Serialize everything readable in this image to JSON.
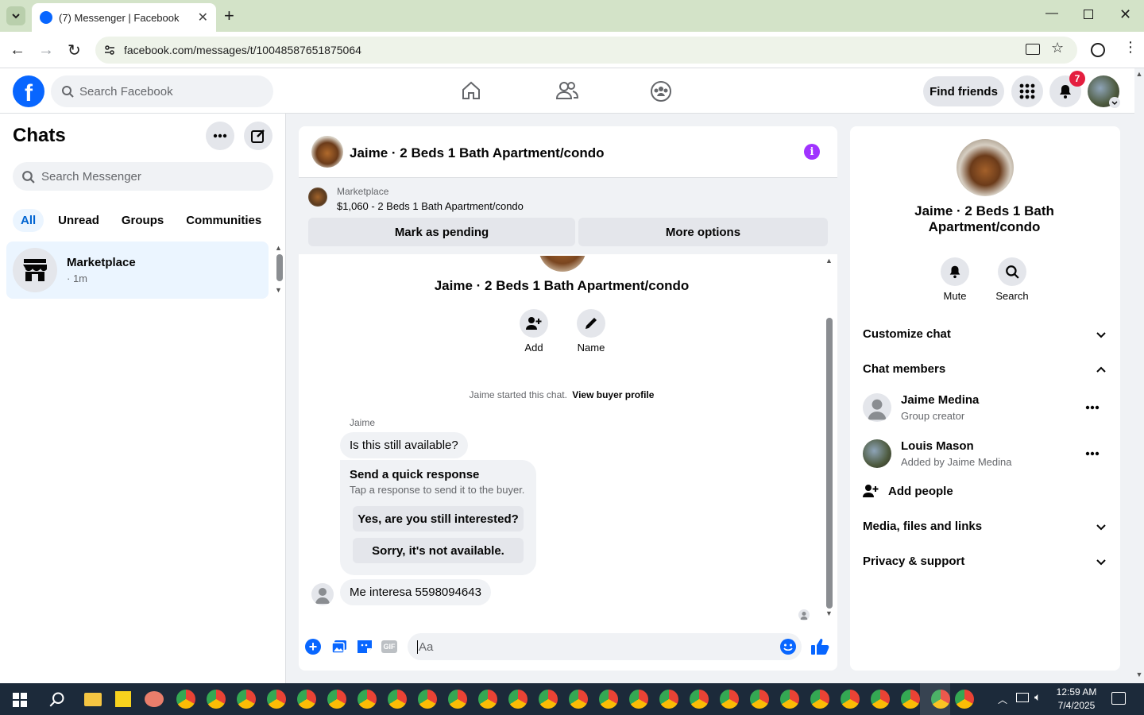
{
  "browser": {
    "tab_title": "(7) Messenger | Facebook",
    "url": "facebook.com/messages/t/10048587651875064"
  },
  "fbnav": {
    "search_placeholder": "Search Facebook",
    "find_friends": "Find friends",
    "notif_count": "7"
  },
  "sidebar": {
    "title": "Chats",
    "search_placeholder": "Search Messenger",
    "filters": [
      "All",
      "Unread",
      "Groups",
      "Communities"
    ],
    "chat_item": {
      "name": "Marketplace",
      "meta": "· 1m"
    }
  },
  "conversation": {
    "header_title": "Jaime · 2 Beds 1 Bath Apartment/condo",
    "marketplace_label": "Marketplace",
    "listing": "$1,060 - 2 Beds 1 Bath Apartment/condo",
    "mark_pending": "Mark as pending",
    "more_options": "More options",
    "profile_title": "Jaime · 2 Beds 1 Bath Apartment/condo",
    "add_label": "Add",
    "name_label": "Name",
    "started_text": "Jaime started this chat.",
    "view_buyer": "View buyer profile",
    "sender_name": "Jaime",
    "msg1": "Is this still available?",
    "quick_title": "Send a quick response",
    "quick_sub": "Tap a response to send it to the buyer.",
    "quick1": "Yes, are you still interested?",
    "quick2": "Sorry, it's not available.",
    "msg2": "Me interesa 5598094643",
    "composer_placeholder": "Aa"
  },
  "rightpanel": {
    "title_line1": "Jaime · 2 Beds 1 Bath",
    "title_line2": "Apartment/condo",
    "mute": "Mute",
    "search": "Search",
    "customize": "Customize chat",
    "members": "Chat members",
    "member1_name": "Jaime Medina",
    "member1_role": "Group creator",
    "member2_name": "Louis Mason",
    "member2_role": "Added by Jaime Medina",
    "add_people": "Add people",
    "media": "Media, files and links",
    "privacy": "Privacy & support"
  },
  "taskbar": {
    "time": "12:59 AM",
    "date": "7/4/2025"
  },
  "colors": {
    "fb_blue": "#0866ff",
    "accent_purple": "#a033ff",
    "badge_red": "#e41e3f"
  }
}
